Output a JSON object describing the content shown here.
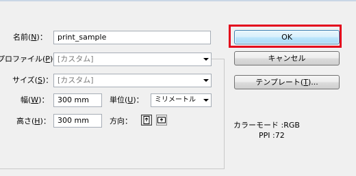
{
  "form": {
    "name_label": "名前(N)：",
    "name_value": "print_sample",
    "profile_label": "プロファイル(P)：",
    "profile_value": "[カスタム]",
    "size_label": "サイズ(S)：",
    "size_value": "[カスタム]",
    "width_label": "幅(W)：",
    "width_value": "300 mm",
    "unit_label": "単位(U)：",
    "unit_value": "ミリメートル",
    "height_label": "高さ(H)：",
    "height_value": "300 mm",
    "orientation_label": "方向："
  },
  "buttons": {
    "ok": "OK",
    "cancel": "キャンセル",
    "template": "テンプレート(T)..."
  },
  "info": {
    "color_mode": "カラーモード :RGB",
    "ppi": "PPI :72"
  },
  "colors": {
    "highlight": "#e3001b",
    "primary_border": "#3c7fb1"
  }
}
